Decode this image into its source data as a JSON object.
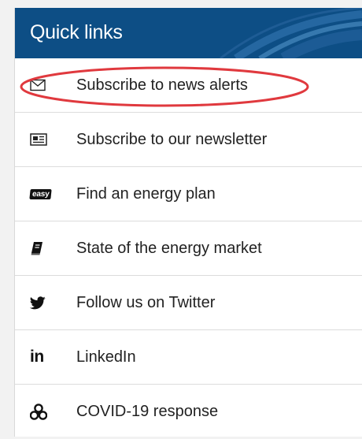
{
  "header": {
    "title": "Quick links",
    "background_color": "#0d4e85"
  },
  "links": [
    {
      "label": "Subscribe to news alerts",
      "icon": "envelope-icon",
      "highlighted": true
    },
    {
      "label": "Subscribe to our newsletter",
      "icon": "newspaper-icon"
    },
    {
      "label": "Find an energy plan",
      "icon": "easy-badge-icon",
      "icon_text": "easy"
    },
    {
      "label": "State of the energy market",
      "icon": "book-icon"
    },
    {
      "label": "Follow us on Twitter",
      "icon": "twitter-icon"
    },
    {
      "label": "LinkedIn",
      "icon": "linkedin-icon",
      "icon_text": "in"
    },
    {
      "label": "COVID-19 response",
      "icon": "biohazard-icon"
    }
  ],
  "colors": {
    "highlight_outline": "#e0393e",
    "text": "#222222",
    "divider": "#dcdcdc"
  }
}
